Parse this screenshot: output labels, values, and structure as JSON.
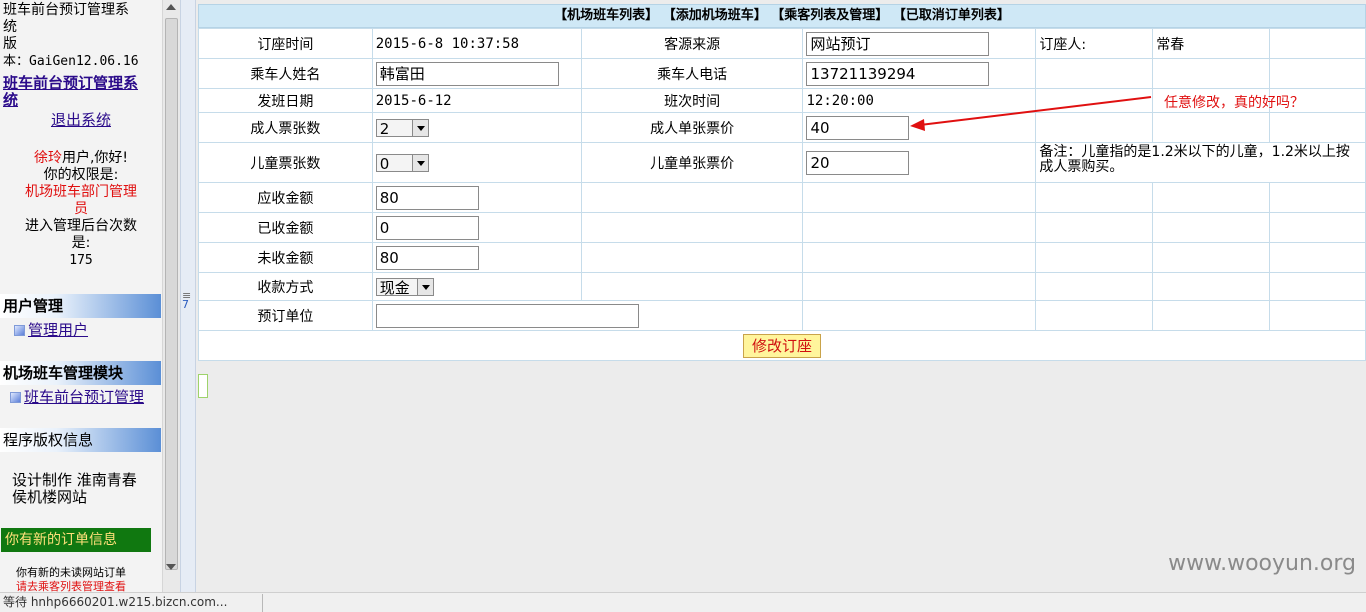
{
  "sidebar": {
    "app_title_line1": "班车前台预订管理系",
    "app_title_line2": "统",
    "version_label": "版",
    "version_value": "本：GaiGen12.06.16",
    "app_link_line1": "班车前台预订管理系",
    "app_link_line2": "统",
    "logout": "退出系统",
    "user_name": "徐玲",
    "greeting": "用户,你好!",
    "permission_label": "你的权限是:",
    "permission_line1": "机场班车部门管理",
    "permission_line2": "员",
    "visits_label_line1": "进入管理后台次数",
    "visits_label_line2": "是:",
    "visits_count": "175",
    "section_user": "用户管理",
    "item_manage_user": "管理用户",
    "section_shuttle": "机场班车管理模块",
    "item_shuttle_booking": "班车前台预订管理",
    "section_copyright": "程序版权信息",
    "design_line1": "设计制作 淮南青春",
    "design_line2": "侯机楼网站",
    "new_order_bar": "你有新的订单信息",
    "unread_line1": "你有新的未读网站订单",
    "unread_line2": "请去乘客列表管理查看"
  },
  "topnav": {
    "item1": "【机场班车列表】",
    "item2": "【添加机场班车】",
    "item3": "【乘客列表及管理】",
    "item4": "【已取消订单列表】"
  },
  "form": {
    "order_time_label": "订座时间",
    "order_time_value": "2015-6-8 10:37:58",
    "source_label": "客源来源",
    "source_value": "网站预订",
    "booker_label": "订座人:",
    "booker_value": "常春",
    "passenger_name_label": "乘车人姓名",
    "passenger_name_value": "韩富田",
    "passenger_phone_label": "乘车人电话",
    "passenger_phone_value": "13721139294",
    "depart_date_label": "发班日期",
    "depart_date_value": "2015-6-12",
    "shift_time_label": "班次时间",
    "shift_time_value": "12:20:00",
    "adult_count_label": "成人票张数",
    "adult_count_value": "2",
    "adult_price_label": "成人单张票价",
    "adult_price_value": "40",
    "child_count_label": "儿童票张数",
    "child_count_value": "0",
    "child_price_label": "儿童单张票价",
    "child_price_value": "20",
    "child_note": "备注：儿童指的是1.2米以下的儿童，1.2米以上按成人票购买。",
    "receivable_label": "应收金额",
    "receivable_value": "80",
    "received_label": "已收金额",
    "received_value": "0",
    "unpaid_label": "未收金额",
    "unpaid_value": "80",
    "payment_label": "收款方式",
    "payment_value": "现金",
    "unit_label": "预订单位",
    "unit_value": "",
    "submit": "修改订座"
  },
  "annotation": "任意修改，真的好吗？",
  "watermark": "www.wooyun.org",
  "status_text": "等待 hnhp6660201.w215.bizcn.com...",
  "colors": {
    "nav_bg": "#cfe8f6",
    "section_gradient_end": "#5b8fd6",
    "new_order_bar": "#107810",
    "highlight_red": "#e01010",
    "button_bg": "#fff59c"
  }
}
